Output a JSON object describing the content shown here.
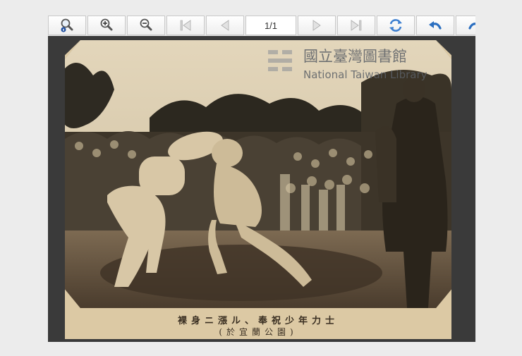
{
  "toolbar": {
    "buttons": [
      {
        "icon": "search-icon"
      },
      {
        "icon": "zoom-in-icon"
      },
      {
        "icon": "zoom-out-icon"
      },
      {
        "icon": "first-page-icon"
      },
      {
        "icon": "previous-page-icon"
      },
      {
        "icon": "next-page-icon"
      },
      {
        "icon": "last-page-icon"
      },
      {
        "icon": "rotate-icon"
      },
      {
        "icon": "undo-icon"
      },
      {
        "icon": "redo-icon"
      }
    ],
    "page_indicator": "1/1"
  },
  "watermark": {
    "title_zh": "國立臺灣圖書館",
    "title_en": "National Taiwan Library"
  },
  "photo": {
    "caption_line1": "裸身ニ漲ル、奉祝少年力士",
    "caption_line2": "(於宜蘭公園)"
  }
}
